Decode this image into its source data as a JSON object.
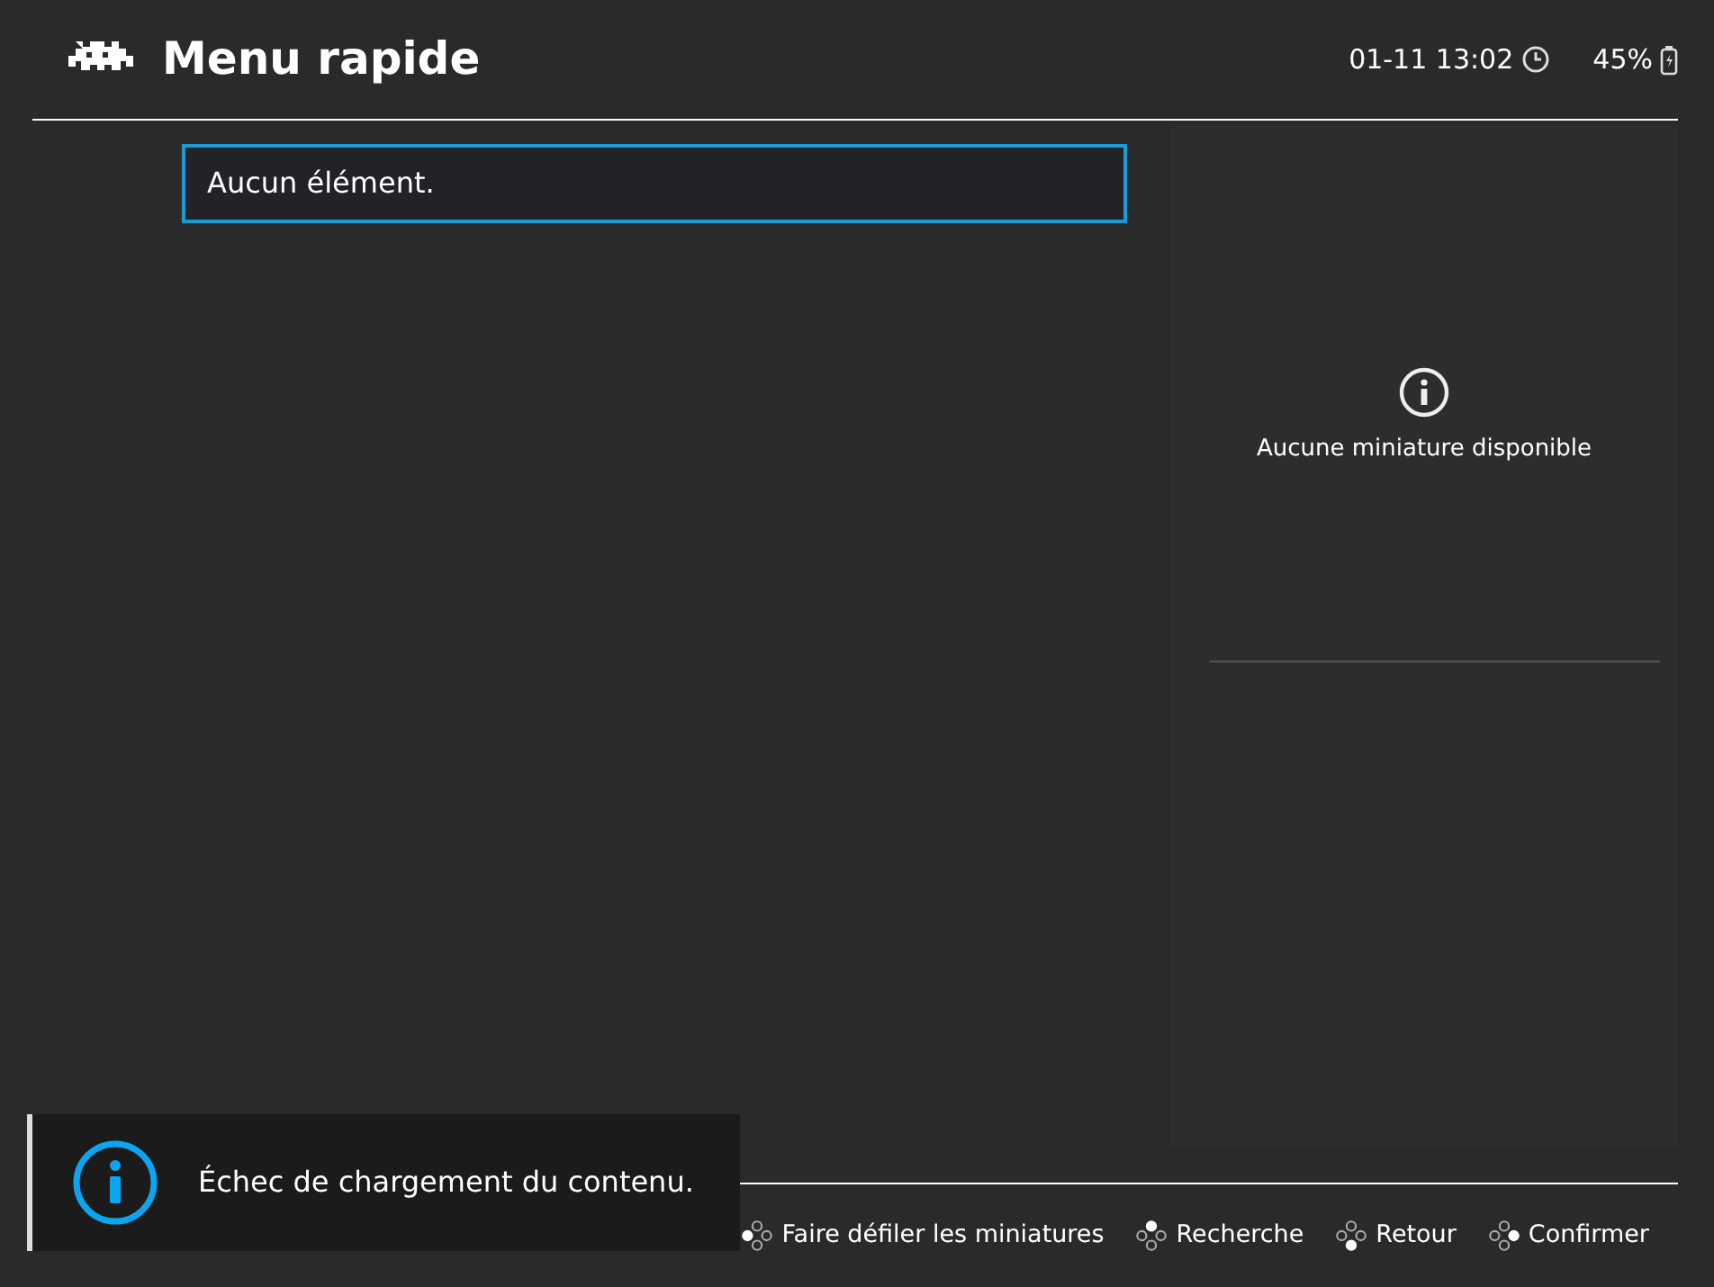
{
  "header": {
    "title": "Menu rapide",
    "clock": "01-11 13:02",
    "battery": "45%"
  },
  "menu": {
    "items": [
      {
        "label": "Aucun élément.",
        "selected": true
      }
    ]
  },
  "thumbnail_panel": {
    "message": "Aucune miniature disponible"
  },
  "footer": {
    "hints": [
      {
        "kind": "left",
        "label": "Faire défiler les miniatures"
      },
      {
        "kind": "up",
        "label": "Recherche"
      },
      {
        "kind": "down",
        "label": "Retour"
      },
      {
        "kind": "right",
        "label": "Confirmer"
      }
    ]
  },
  "notification": {
    "message": "Échec de chargement du contenu."
  }
}
